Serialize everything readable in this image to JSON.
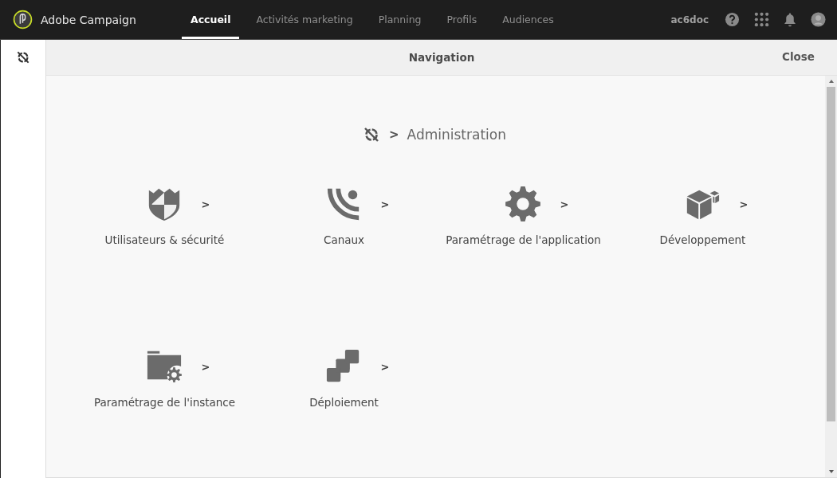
{
  "header": {
    "brand": "Adobe Campaign",
    "tabs": [
      {
        "label": "Accueil",
        "selected": true
      },
      {
        "label": "Activités marketing",
        "selected": false
      },
      {
        "label": "Planning",
        "selected": false
      },
      {
        "label": "Profils",
        "selected": false
      },
      {
        "label": "Audiences",
        "selected": false
      }
    ],
    "user": "ac6doc"
  },
  "panel": {
    "title": "Navigation",
    "close": "Close",
    "breadcrumb_separator": ">",
    "breadcrumb": "Administration",
    "items": [
      {
        "kind": "shield",
        "label": "Utilisateurs & sécurité",
        "chevron": ">"
      },
      {
        "kind": "channels",
        "label": "Canaux",
        "chevron": ">"
      },
      {
        "kind": "gear",
        "label": "Paramétrage de l'application",
        "chevron": ">"
      },
      {
        "kind": "cubes",
        "label": "Développement",
        "chevron": ">"
      },
      {
        "kind": "folder-gear",
        "label": "Paramétrage de l'instance",
        "chevron": ">"
      },
      {
        "kind": "squares",
        "label": "Déploiement",
        "chevron": ">"
      }
    ]
  }
}
